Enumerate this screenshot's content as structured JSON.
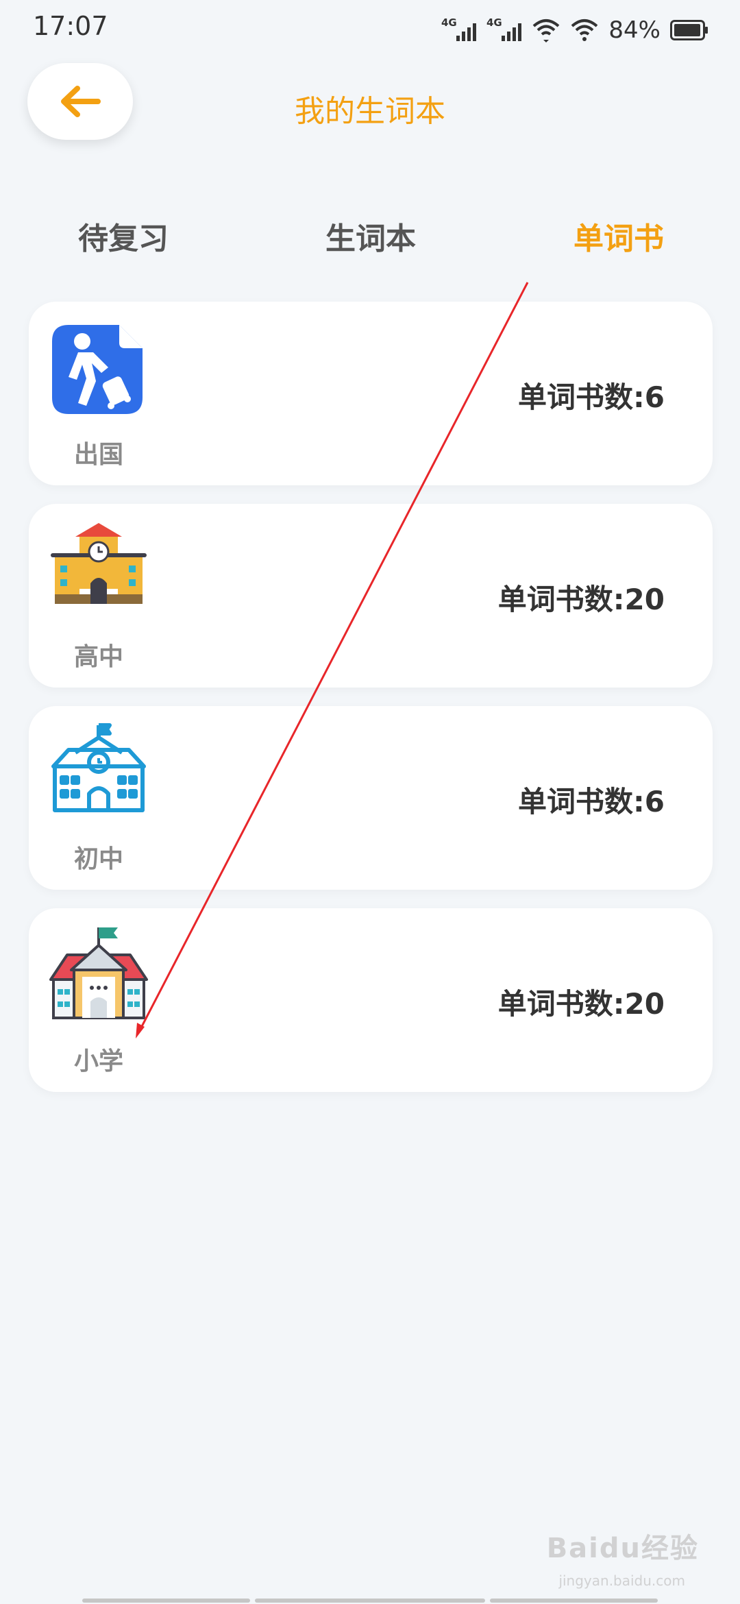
{
  "status_bar": {
    "time": "17:07",
    "signal1_label": "4G",
    "signal2_label": "4G",
    "battery_percent": "84%"
  },
  "header": {
    "title": "我的生词本",
    "back_icon": "arrow-left-icon"
  },
  "tabs": [
    {
      "label": "待复习",
      "active": false
    },
    {
      "label": "生词本",
      "active": false
    },
    {
      "label": "单词书",
      "active": true
    }
  ],
  "books": [
    {
      "name": "出国",
      "count_label": "单词书数:6",
      "icon": "travel-icon"
    },
    {
      "name": "高中",
      "count_label": "单词书数:20",
      "icon": "high-school-icon"
    },
    {
      "name": "初中",
      "count_label": "单词书数:6",
      "icon": "middle-school-icon"
    },
    {
      "name": "小学",
      "count_label": "单词书数:20",
      "icon": "primary-school-icon"
    }
  ],
  "watermark": {
    "main": "Baidu经验",
    "sub": "jingyan.baidu.com"
  },
  "colors": {
    "accent": "#f3a012",
    "background": "#f3f6f9",
    "card": "#ffffff",
    "annotation": "#e8262a"
  }
}
